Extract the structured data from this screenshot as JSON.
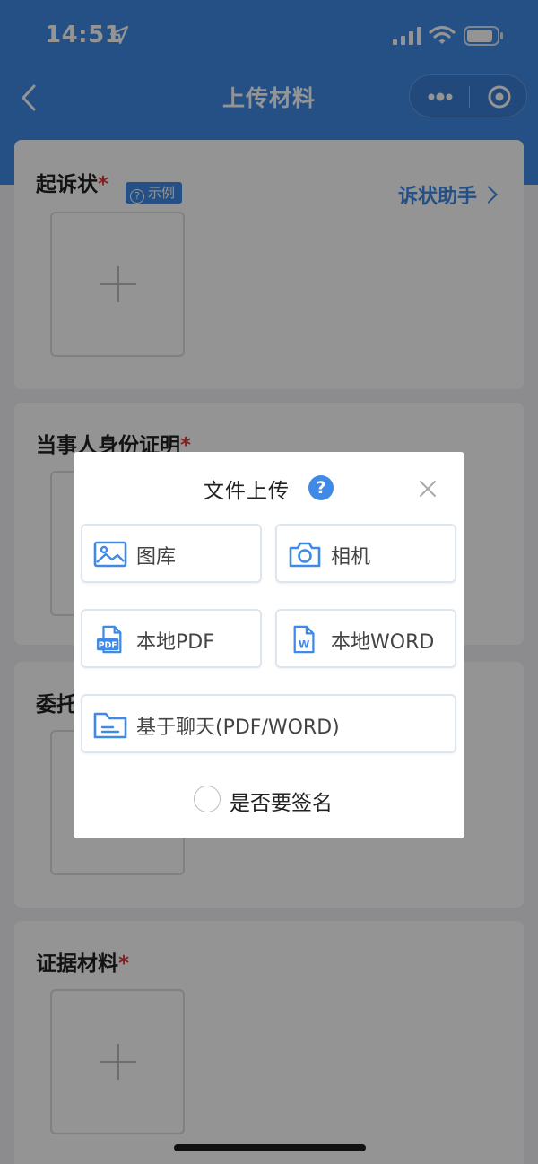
{
  "status_bar": {
    "time": "14:51"
  },
  "navbar": {
    "title": "上传材料"
  },
  "cards": [
    {
      "label": "起诉状",
      "required_mark": "*",
      "example_tag": "示例",
      "assistant_link": "诉状助手"
    },
    {
      "label": "当事人身份证明",
      "required_mark": "*"
    },
    {
      "label": "委托",
      "required_mark": ""
    },
    {
      "label": "证据材料",
      "required_mark": "*"
    }
  ],
  "modal": {
    "title": "文件上传",
    "help_glyph": "?",
    "options": {
      "gallery": "图库",
      "camera": "相机",
      "local_pdf": "本地PDF",
      "local_word": "本地WORD",
      "chat": "基于聊天(PDF/WORD)"
    },
    "pdf_badge": "PDF",
    "word_badge": "W",
    "sign_label": "是否要签名"
  },
  "colors": {
    "primary": "#3f8ae6",
    "required": "#e23a3a"
  }
}
